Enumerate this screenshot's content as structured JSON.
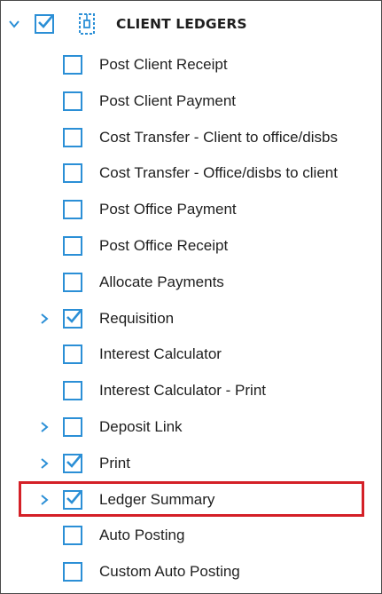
{
  "colors": {
    "accent": "#2b8fd6",
    "highlight": "#d42027"
  },
  "root": {
    "label": "CLIENT LEDGERS",
    "checked": true,
    "expanded": true,
    "icon": "module-icon"
  },
  "items": [
    {
      "label": "Post Client Receipt",
      "checked": false,
      "expandable": false
    },
    {
      "label": "Post Client Payment",
      "checked": false,
      "expandable": false
    },
    {
      "label": "Cost Transfer - Client to office/disbs",
      "checked": false,
      "expandable": false
    },
    {
      "label": "Cost Transfer - Office/disbs to client",
      "checked": false,
      "expandable": false
    },
    {
      "label": "Post Office Payment",
      "checked": false,
      "expandable": false
    },
    {
      "label": "Post Office Receipt",
      "checked": false,
      "expandable": false
    },
    {
      "label": "Allocate Payments",
      "checked": false,
      "expandable": false
    },
    {
      "label": "Requisition",
      "checked": true,
      "expandable": true
    },
    {
      "label": "Interest Calculator",
      "checked": false,
      "expandable": false
    },
    {
      "label": "Interest Calculator - Print",
      "checked": false,
      "expandable": false
    },
    {
      "label": "Deposit Link",
      "checked": false,
      "expandable": true
    },
    {
      "label": "Print",
      "checked": true,
      "expandable": true
    },
    {
      "label": "Ledger Summary",
      "checked": true,
      "expandable": true,
      "highlighted": true
    },
    {
      "label": "Auto Posting",
      "checked": false,
      "expandable": false
    },
    {
      "label": "Custom Auto Posting",
      "checked": false,
      "expandable": false
    }
  ]
}
